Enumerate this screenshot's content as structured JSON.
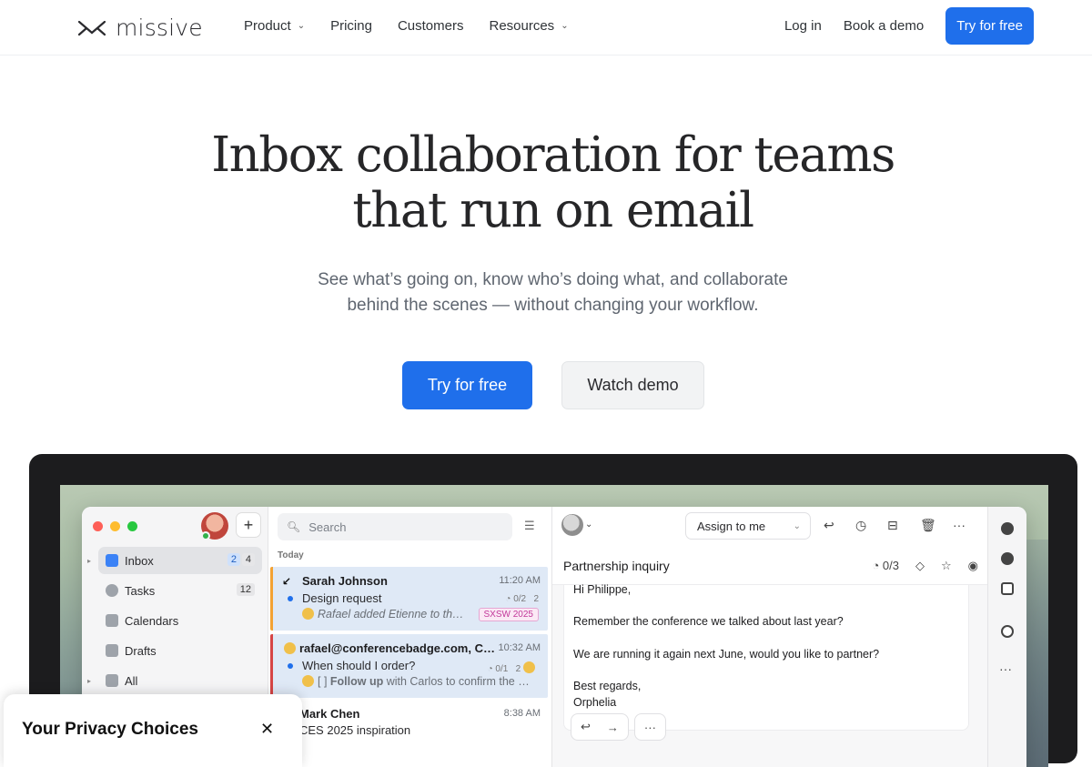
{
  "nav": {
    "logo": "missive",
    "links": [
      {
        "label": "Product",
        "dropdown": true
      },
      {
        "label": "Pricing",
        "dropdown": false
      },
      {
        "label": "Customers",
        "dropdown": false
      },
      {
        "label": "Resources",
        "dropdown": true
      }
    ],
    "login": "Log in",
    "book_demo": "Book a demo",
    "try_free": "Try for free"
  },
  "hero": {
    "title_line1": "Inbox collaboration for teams",
    "title_line2": "that run on email",
    "subtitle_line1": "See what’s going on, know who’s doing what, and collaborate",
    "subtitle_line2": "behind the scenes — without changing your workflow.",
    "cta_primary": "Try for free",
    "cta_secondary": "Watch demo"
  },
  "app": {
    "sidebar": [
      {
        "label": "Inbox",
        "badge1": "2",
        "badge2": "4"
      },
      {
        "label": "Tasks",
        "badge2": "12"
      },
      {
        "label": "Calendars"
      },
      {
        "label": "Drafts"
      },
      {
        "label": "All"
      }
    ],
    "search_placeholder": "Search",
    "today": "Today",
    "messages": [
      {
        "from": "Sarah Johnson",
        "time": "11:20 AM",
        "subject": "Design request",
        "preview": "Rafael added Etienne to th…",
        "meta": "0/2",
        "count": "2",
        "tag": "SXSW 2025"
      },
      {
        "from": "rafael@conferencebadge.com, C…",
        "time": "10:32 AM",
        "subject": "When should I order?",
        "preview_prefix": "[ ] ",
        "preview_bold": "Follow up",
        "preview_rest": " with Carlos to confirm the …",
        "meta": "0/1",
        "count": "2"
      },
      {
        "from": "Mark Chen",
        "time": "8:38 AM",
        "subject": "CES 2025 inspiration"
      }
    ],
    "assign": "Assign to me",
    "subject": "Partnership inquiry",
    "task_count": "0/3",
    "email_lines": [
      "Hi Philippe,",
      "Remember the conference we talked about last year?",
      "We are running it again next June, would you like to partner?",
      "Best regards,",
      "Orphelia"
    ]
  },
  "privacy": {
    "title": "Your Privacy Choices",
    "close": "✕"
  },
  "colors": {
    "accent": "#1f6feb"
  }
}
